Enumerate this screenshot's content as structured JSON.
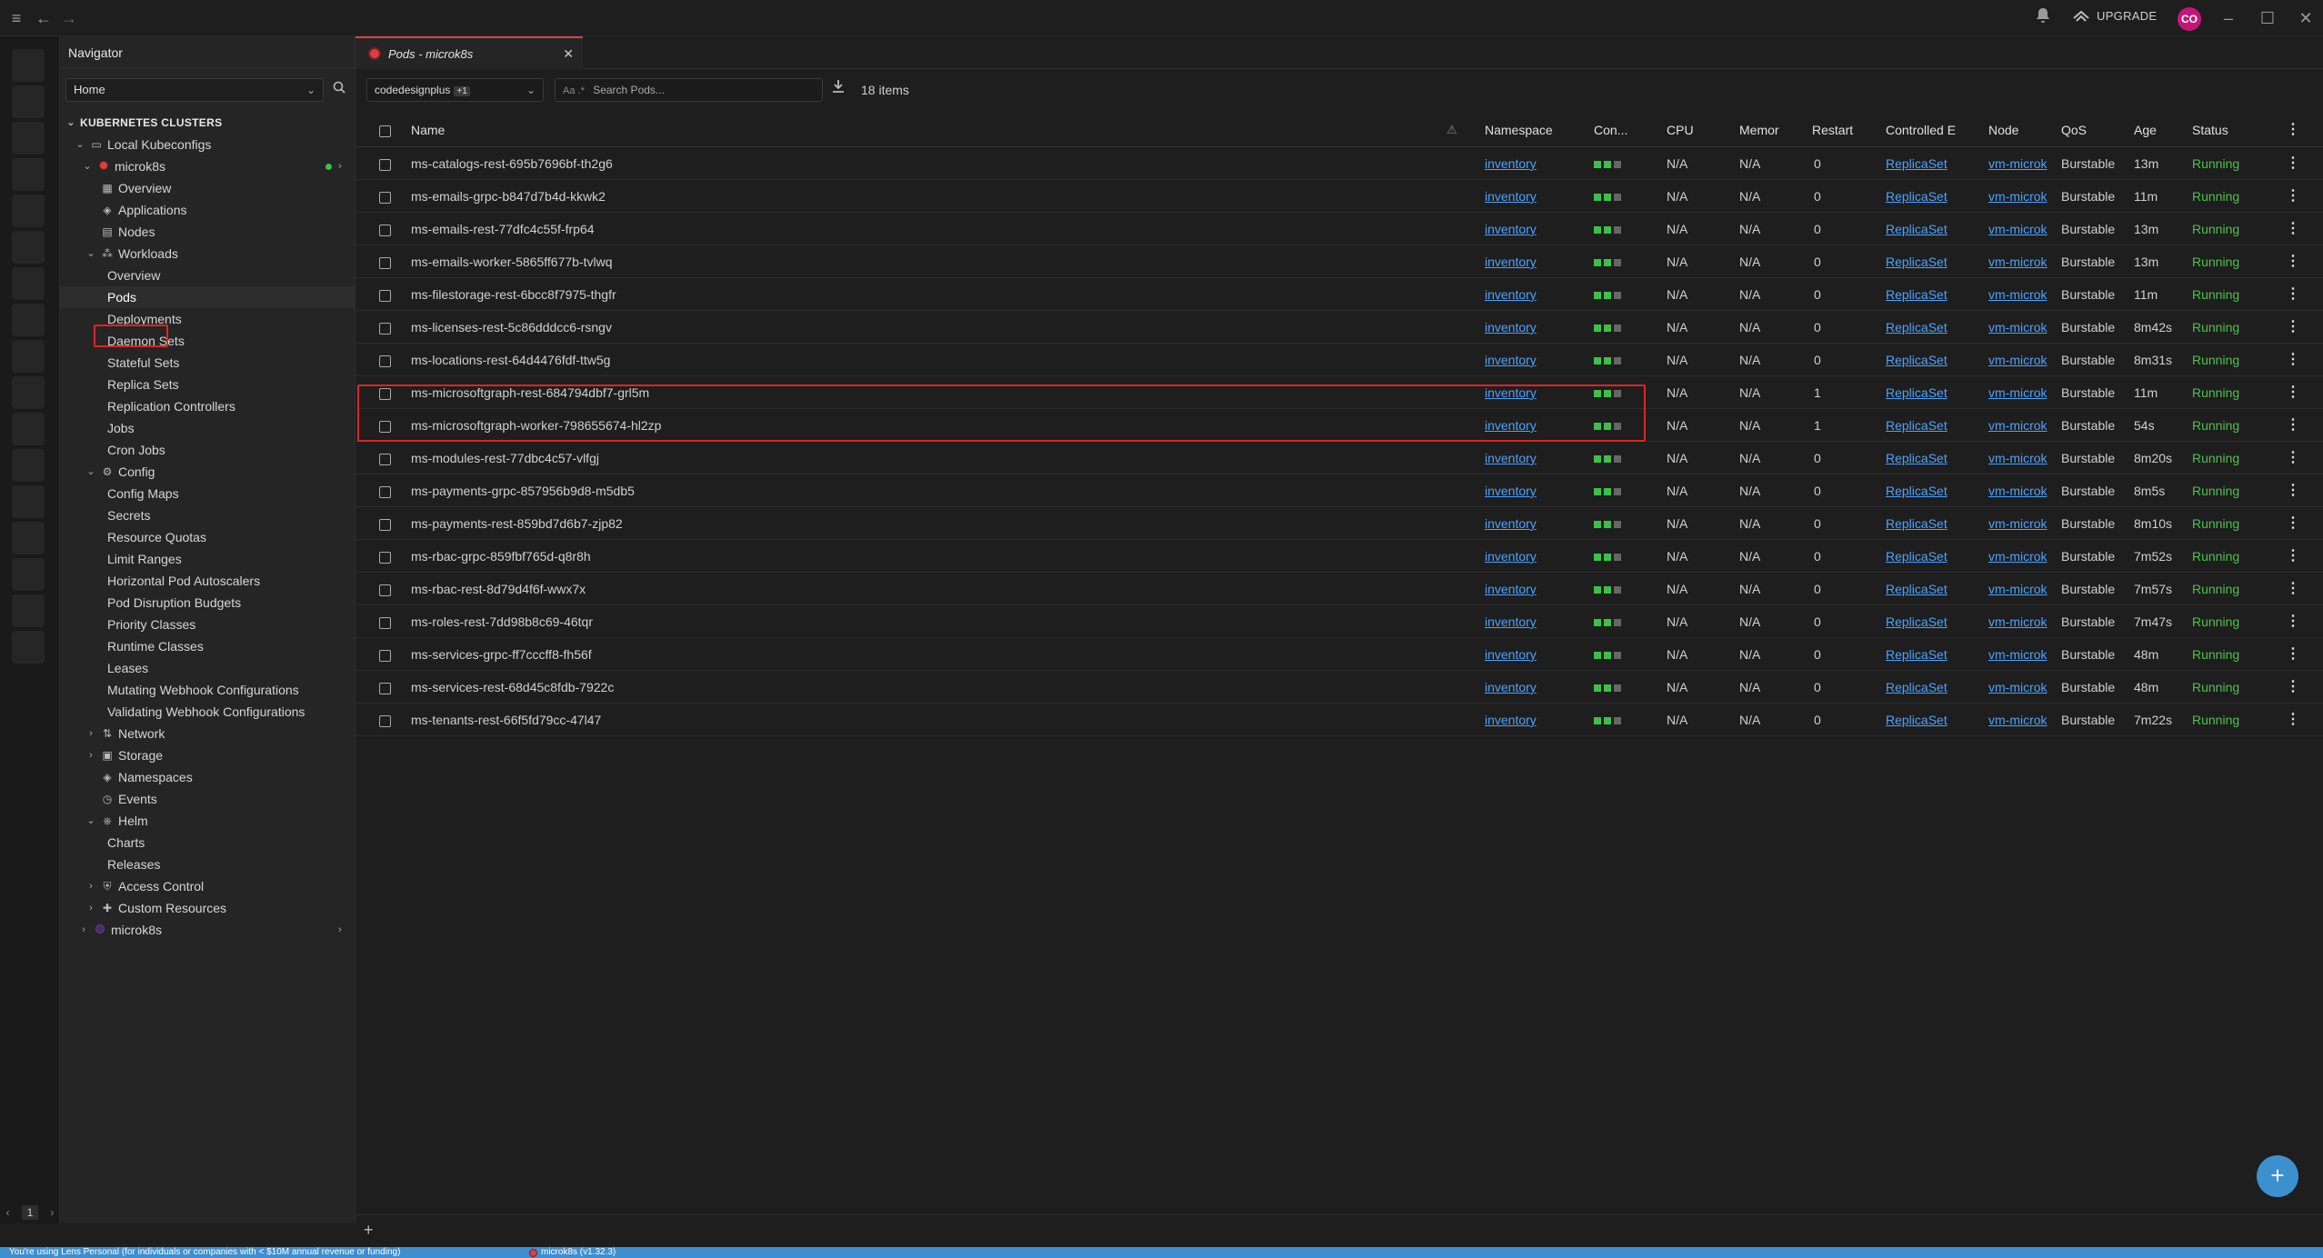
{
  "topbar": {
    "upgrade_label": "UPGRADE",
    "avatar_initials": "CO"
  },
  "sidebar": {
    "title": "Navigator",
    "home_select": "Home",
    "section_clusters": "KUBERNETES CLUSTERS",
    "local_kubeconfigs": "Local Kubeconfigs",
    "cluster_name": "microk8s",
    "items": {
      "overview": "Overview",
      "applications": "Applications",
      "nodes": "Nodes",
      "workloads": "Workloads",
      "wl_overview": "Overview",
      "pods": "Pods",
      "deployments": "Deployments",
      "daemon_sets": "Daemon Sets",
      "stateful_sets": "Stateful Sets",
      "replica_sets": "Replica Sets",
      "replication_controllers": "Replication Controllers",
      "jobs": "Jobs",
      "cron_jobs": "Cron Jobs",
      "config": "Config",
      "config_maps": "Config Maps",
      "secrets": "Secrets",
      "resource_quotas": "Resource Quotas",
      "limit_ranges": "Limit Ranges",
      "hpa": "Horizontal Pod Autoscalers",
      "pdb": "Pod Disruption Budgets",
      "priority_classes": "Priority Classes",
      "runtime_classes": "Runtime Classes",
      "leases": "Leases",
      "mutating_webhooks": "Mutating Webhook Configurations",
      "validating_webhooks": "Validating Webhook Configurations",
      "network": "Network",
      "storage": "Storage",
      "namespaces": "Namespaces",
      "events": "Events",
      "helm": "Helm",
      "charts": "Charts",
      "releases": "Releases",
      "access_control": "Access Control",
      "custom_resources": "Custom Resources",
      "cluster2": "microk8s"
    },
    "footer_page": "1"
  },
  "tab": {
    "label": "Pods - microk8s"
  },
  "toolbar": {
    "namespace": "codedesignplus",
    "namespace_extra": "+1",
    "search_aa": "Aa .*",
    "search_placeholder": "Search Pods...",
    "items_count": "18 items"
  },
  "table": {
    "headers": {
      "name": "Name",
      "namespace": "Namespace",
      "containers": "Con...",
      "cpu": "CPU",
      "memory": "Memor",
      "restarts": "Restart",
      "controlled_by": "Controlled E",
      "node": "Node",
      "qos": "QoS",
      "age": "Age",
      "status": "Status"
    },
    "rows": [
      {
        "name": "ms-catalogs-rest-695b7696bf-th2g6",
        "namespace": "inventory",
        "cpu": "N/A",
        "memory": "N/A",
        "restarts": "0",
        "controlled_by": "ReplicaSet",
        "node": "vm-microk",
        "qos": "Burstable",
        "age": "13m",
        "status": "Running"
      },
      {
        "name": "ms-emails-grpc-b847d7b4d-kkwk2",
        "namespace": "inventory",
        "cpu": "N/A",
        "memory": "N/A",
        "restarts": "0",
        "controlled_by": "ReplicaSet",
        "node": "vm-microk",
        "qos": "Burstable",
        "age": "11m",
        "status": "Running"
      },
      {
        "name": "ms-emails-rest-77dfc4c55f-frp64",
        "namespace": "inventory",
        "cpu": "N/A",
        "memory": "N/A",
        "restarts": "0",
        "controlled_by": "ReplicaSet",
        "node": "vm-microk",
        "qos": "Burstable",
        "age": "13m",
        "status": "Running"
      },
      {
        "name": "ms-emails-worker-5865ff677b-tvlwq",
        "namespace": "inventory",
        "cpu": "N/A",
        "memory": "N/A",
        "restarts": "0",
        "controlled_by": "ReplicaSet",
        "node": "vm-microk",
        "qos": "Burstable",
        "age": "13m",
        "status": "Running"
      },
      {
        "name": "ms-filestorage-rest-6bcc8f7975-thgfr",
        "namespace": "inventory",
        "cpu": "N/A",
        "memory": "N/A",
        "restarts": "0",
        "controlled_by": "ReplicaSet",
        "node": "vm-microk",
        "qos": "Burstable",
        "age": "11m",
        "status": "Running"
      },
      {
        "name": "ms-licenses-rest-5c86dddcc6-rsngv",
        "namespace": "inventory",
        "cpu": "N/A",
        "memory": "N/A",
        "restarts": "0",
        "controlled_by": "ReplicaSet",
        "node": "vm-microk",
        "qos": "Burstable",
        "age": "8m42s",
        "status": "Running"
      },
      {
        "name": "ms-locations-rest-64d4476fdf-ttw5g",
        "namespace": "inventory",
        "cpu": "N/A",
        "memory": "N/A",
        "restarts": "0",
        "controlled_by": "ReplicaSet",
        "node": "vm-microk",
        "qos": "Burstable",
        "age": "8m31s",
        "status": "Running"
      },
      {
        "name": "ms-microsoftgraph-rest-684794dbf7-grl5m",
        "namespace": "inventory",
        "cpu": "N/A",
        "memory": "N/A",
        "restarts": "1",
        "controlled_by": "ReplicaSet",
        "node": "vm-microk",
        "qos": "Burstable",
        "age": "11m",
        "status": "Running"
      },
      {
        "name": "ms-microsoftgraph-worker-798655674-hl2zp",
        "namespace": "inventory",
        "cpu": "N/A",
        "memory": "N/A",
        "restarts": "1",
        "controlled_by": "ReplicaSet",
        "node": "vm-microk",
        "qos": "Burstable",
        "age": "54s",
        "status": "Running"
      },
      {
        "name": "ms-modules-rest-77dbc4c57-vlfgj",
        "namespace": "inventory",
        "cpu": "N/A",
        "memory": "N/A",
        "restarts": "0",
        "controlled_by": "ReplicaSet",
        "node": "vm-microk",
        "qos": "Burstable",
        "age": "8m20s",
        "status": "Running"
      },
      {
        "name": "ms-payments-grpc-857956b9d8-m5db5",
        "namespace": "inventory",
        "cpu": "N/A",
        "memory": "N/A",
        "restarts": "0",
        "controlled_by": "ReplicaSet",
        "node": "vm-microk",
        "qos": "Burstable",
        "age": "8m5s",
        "status": "Running"
      },
      {
        "name": "ms-payments-rest-859bd7d6b7-zjp82",
        "namespace": "inventory",
        "cpu": "N/A",
        "memory": "N/A",
        "restarts": "0",
        "controlled_by": "ReplicaSet",
        "node": "vm-microk",
        "qos": "Burstable",
        "age": "8m10s",
        "status": "Running"
      },
      {
        "name": "ms-rbac-grpc-859fbf765d-q8r8h",
        "namespace": "inventory",
        "cpu": "N/A",
        "memory": "N/A",
        "restarts": "0",
        "controlled_by": "ReplicaSet",
        "node": "vm-microk",
        "qos": "Burstable",
        "age": "7m52s",
        "status": "Running"
      },
      {
        "name": "ms-rbac-rest-8d79d4f6f-wwx7x",
        "namespace": "inventory",
        "cpu": "N/A",
        "memory": "N/A",
        "restarts": "0",
        "controlled_by": "ReplicaSet",
        "node": "vm-microk",
        "qos": "Burstable",
        "age": "7m57s",
        "status": "Running"
      },
      {
        "name": "ms-roles-rest-7dd98b8c69-46tqr",
        "namespace": "inventory",
        "cpu": "N/A",
        "memory": "N/A",
        "restarts": "0",
        "controlled_by": "ReplicaSet",
        "node": "vm-microk",
        "qos": "Burstable",
        "age": "7m47s",
        "status": "Running"
      },
      {
        "name": "ms-services-grpc-ff7cccff8-fh56f",
        "namespace": "inventory",
        "cpu": "N/A",
        "memory": "N/A",
        "restarts": "0",
        "controlled_by": "ReplicaSet",
        "node": "vm-microk",
        "qos": "Burstable",
        "age": "48m",
        "status": "Running"
      },
      {
        "name": "ms-services-rest-68d45c8fdb-7922c",
        "namespace": "inventory",
        "cpu": "N/A",
        "memory": "N/A",
        "restarts": "0",
        "controlled_by": "ReplicaSet",
        "node": "vm-microk",
        "qos": "Burstable",
        "age": "48m",
        "status": "Running"
      },
      {
        "name": "ms-tenants-rest-66f5fd79cc-47l47",
        "namespace": "inventory",
        "cpu": "N/A",
        "memory": "N/A",
        "restarts": "0",
        "controlled_by": "ReplicaSet",
        "node": "vm-microk",
        "qos": "Burstable",
        "age": "7m22s",
        "status": "Running"
      }
    ]
  },
  "statusbar": {
    "message": "You're using Lens Personal (for individuals or companies with < $10M annual revenue or funding)",
    "context": "microk8s (v1.32.3)"
  },
  "colors": {
    "accent": "#3d8fd1",
    "running": "#4cc24c",
    "highlight": "#e02424",
    "link": "#4aa3ff"
  }
}
